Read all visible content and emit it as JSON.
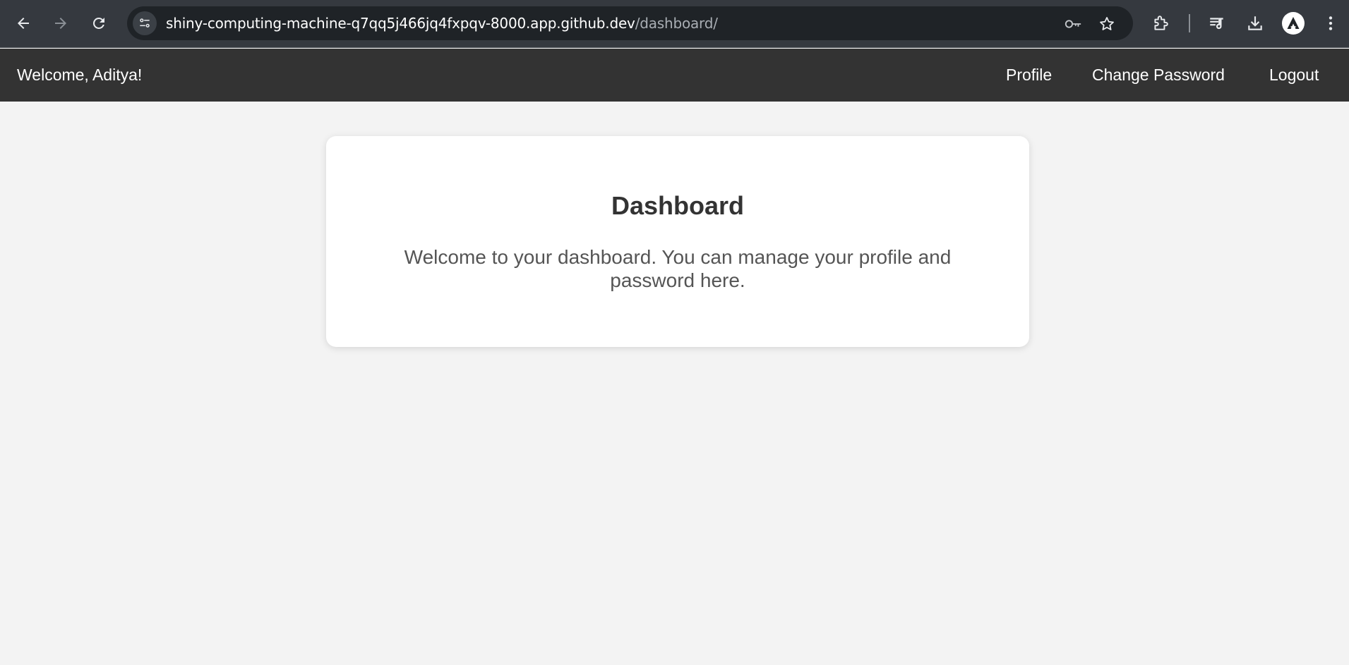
{
  "browser": {
    "url_host": "shiny-computing-machine-q7qq5j466jq4fxpqv-8000.app.github.dev",
    "url_path": "/dashboard/",
    "icons": [
      "back-icon",
      "forward-icon",
      "reload-icon",
      "site-info-icon",
      "password-key-icon",
      "bookmark-star-icon",
      "extensions-icon",
      "media-controls-icon",
      "downloads-icon",
      "profile-avatar-icon",
      "menu-icon"
    ]
  },
  "nav": {
    "welcome": "Welcome, Aditya!",
    "links": {
      "profile": "Profile",
      "change_password": "Change Password",
      "logout": "Logout"
    },
    "background": "#333333"
  },
  "main": {
    "title": "Dashboard",
    "message": "Welcome to your dashboard. You can manage your profile and password here."
  }
}
